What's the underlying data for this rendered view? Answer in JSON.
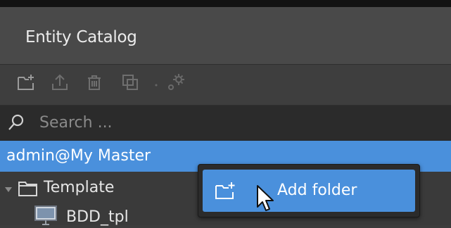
{
  "panel": {
    "title": "Entity Catalog"
  },
  "toolbar": {
    "icons": [
      "add-folder-icon",
      "upload-icon",
      "trash-icon",
      "duplicate-icon",
      "settings-icon"
    ]
  },
  "search": {
    "placeholder": "Search ..."
  },
  "tree": {
    "root": {
      "label": "admin@My Master"
    },
    "folder": {
      "label": "Template"
    },
    "item": {
      "label": "BDD_tpl"
    }
  },
  "context_menu": {
    "items": [
      {
        "label": "Add folder",
        "icon": "add-folder-icon"
      }
    ]
  },
  "colors": {
    "selection": "#4a90dc",
    "panel_bg": "#3c3c3c",
    "title_bg": "#494949",
    "search_bg": "#2b2b2b"
  }
}
